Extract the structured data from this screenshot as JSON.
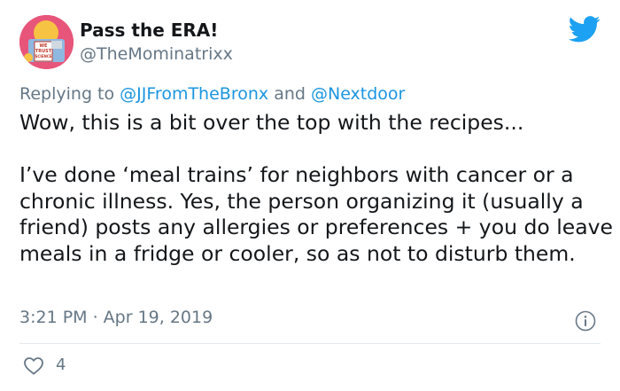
{
  "author": {
    "display_name": "Pass the ERA!",
    "handle": "@TheMominatrixx",
    "avatar_text": "WE TRUST SCIENCE"
  },
  "reply": {
    "prefix": "Replying to",
    "mention_1": "@JJFromTheBronx",
    "conjunction": "and",
    "mention_2": "@Nextdoor"
  },
  "body": {
    "paragraph_1": "Wow, this is a bit over the top with the recipes...",
    "paragraph_2": "I’ve done ‘meal trains’ for neighbors with cancer or a chronic illness. Yes, the person organizing it (usually a friend) posts any allergies or preferences + you do leave meals in a fridge or cooler, so as not to disturb them."
  },
  "meta": {
    "timestamp": "3:21 PM · Apr 19, 2019"
  },
  "actions": {
    "like_count": "4"
  },
  "colors": {
    "twitter_blue": "#1da1f2",
    "mention_blue": "#1b95e0",
    "secondary_text": "#657786",
    "divider": "#e1e8ed"
  },
  "icons": [
    "twitter-bird-icon",
    "info-icon",
    "heart-icon"
  ]
}
